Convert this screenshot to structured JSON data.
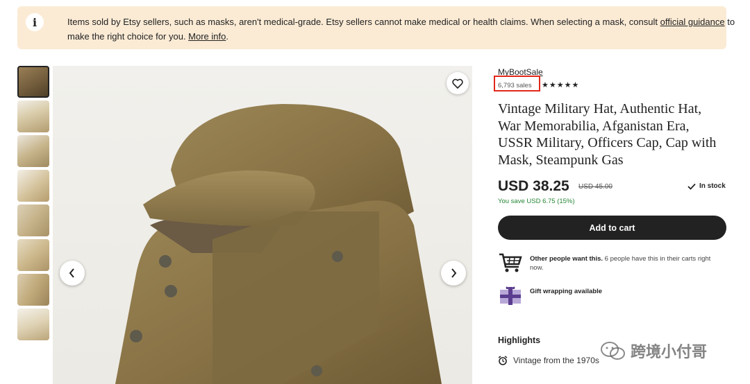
{
  "notice": {
    "icon": "info-icon",
    "text_before": "Items sold by Etsy sellers, such as masks, aren't medical-grade. Etsy sellers cannot make medical or health claims. When selecting a mask, consult ",
    "link_guidance": "official guidance",
    "text_middle": " to make the right choice for you. ",
    "link_more": "More info",
    "text_end": "."
  },
  "gallery": {
    "thumbnail_count": 8,
    "active_index": 0
  },
  "listing": {
    "shop_name": "MyBootSale",
    "sales": "6,793 sales",
    "stars": "★★★★★",
    "title": "Vintage Military Hat, Authentic Hat, War Memorabilia, Afganistan Era, USSR Military, Officers Cap, Cap with Mask, Steampunk Gas",
    "price": "USD 38.25",
    "original_price": "USD 45.00",
    "stock": "In stock",
    "savings": "You save USD 6.75 (15%)",
    "add_to_cart": "Add to cart",
    "feature_demand_bold": "Other people want this.",
    "feature_demand_rest": " 6 people have this in their carts right now.",
    "feature_gift": "Gift wrapping available",
    "highlights_heading": "Highlights",
    "highlight_1": "Vintage from the 1970s"
  },
  "colors": {
    "notice_bg": "#fbebd5",
    "button_bg": "#222222",
    "savings_green": "#258635",
    "annotation_red": "#e1271a"
  },
  "watermark": {
    "text": "跨境小付哥"
  }
}
